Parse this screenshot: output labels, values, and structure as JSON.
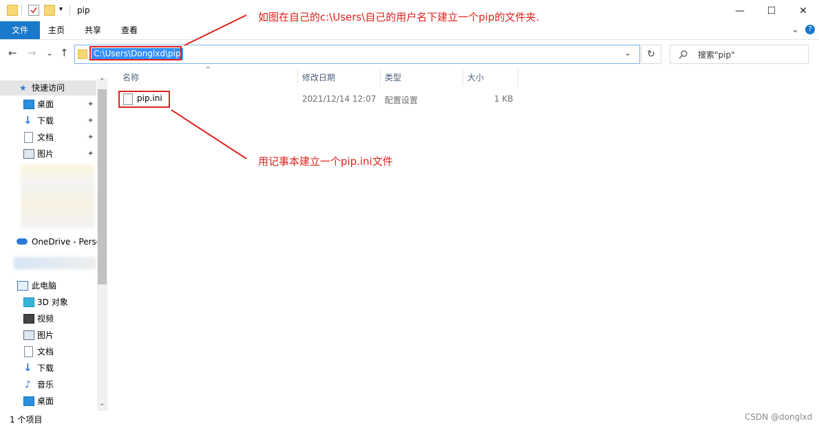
{
  "window": {
    "title": "pip",
    "minimize": "—",
    "maximize": "☐",
    "close": "✕"
  },
  "ribbon": {
    "tabs": [
      "文件",
      "主页",
      "共享",
      "查看"
    ],
    "help": "?",
    "expand": "⌄"
  },
  "nav": {
    "back": "←",
    "forward": "→",
    "recent": "⌄",
    "up": "↑",
    "address": "C:\\Users\\Donglxd\\pip",
    "dropdown": "⌄",
    "refresh": "↻",
    "search_placeholder": "搜索\"pip\""
  },
  "sidebar": {
    "quick_access": "快速访问",
    "pinned": [
      {
        "label": "桌面",
        "icon": "desktop-icon"
      },
      {
        "label": "下载",
        "icon": "download-icon"
      },
      {
        "label": "文档",
        "icon": "document-icon"
      },
      {
        "label": "图片",
        "icon": "picture-icon"
      }
    ],
    "onedrive": "OneDrive - Perso",
    "this_pc": "此电脑",
    "pc_items": [
      {
        "label": "3D 对象",
        "icon": "3d-objects-icon"
      },
      {
        "label": "视频",
        "icon": "video-icon"
      },
      {
        "label": "图片",
        "icon": "picture-icon"
      },
      {
        "label": "文档",
        "icon": "document-icon"
      },
      {
        "label": "下载",
        "icon": "download-icon"
      },
      {
        "label": "音乐",
        "icon": "music-icon"
      },
      {
        "label": "桌面",
        "icon": "desktop-icon"
      }
    ],
    "pin_glyph": "📌",
    "scroll_up": "⌃",
    "scroll_down": "⌄"
  },
  "table": {
    "sort_arrow": "^",
    "headers": [
      "名称",
      "修改日期",
      "类型",
      "大小"
    ],
    "rows": [
      {
        "name": "pip.ini",
        "modified": "2021/12/14 12:07",
        "type": "配置设置",
        "size": "1 KB"
      }
    ]
  },
  "annotations": {
    "top": "如图在自己的c:\\Users\\自己的用户名下建立一个pip的文件夹.",
    "middle": "用记事本建立一个pip.ini文件"
  },
  "status": {
    "count": "1 个项目",
    "watermark": "CSDN @donglxd"
  },
  "colors": {
    "accent": "#1979ca",
    "annotation": "#e0201b",
    "selection": "#3390ff",
    "folder": "#f8d775"
  }
}
